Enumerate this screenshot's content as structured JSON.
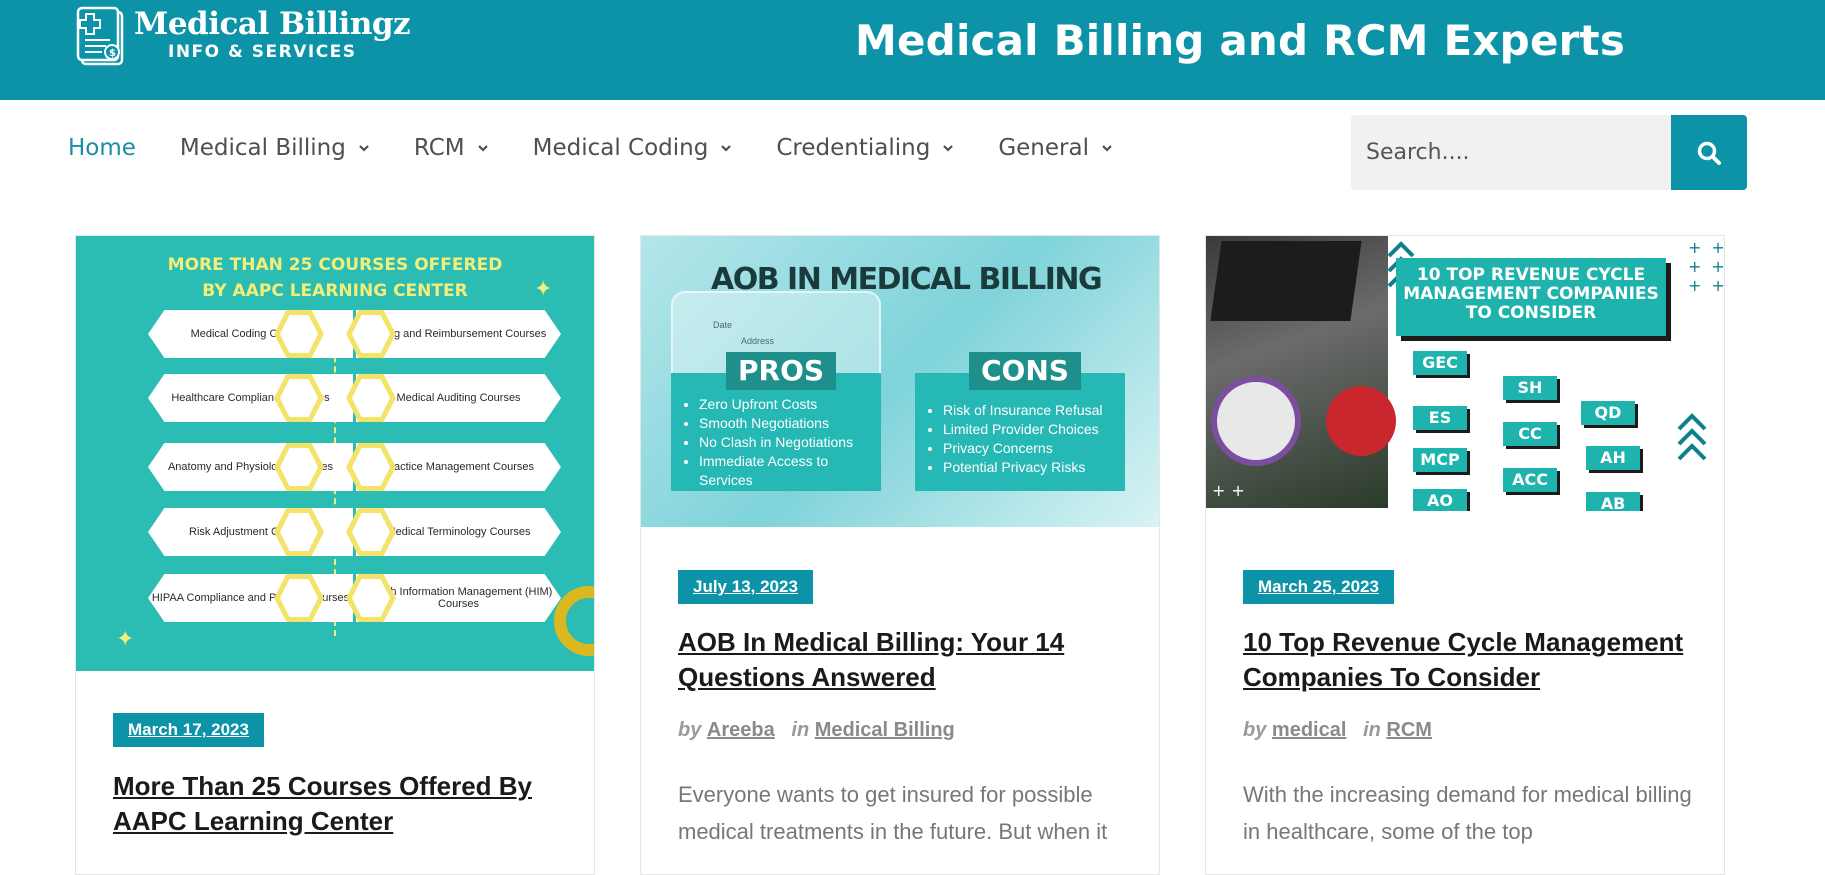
{
  "header": {
    "logo_name": "Medical Billingz",
    "logo_sub": "INFO & SERVICES",
    "tagline": "Medical Billing and RCM Experts"
  },
  "nav": {
    "items": [
      {
        "label": "Home",
        "active": true,
        "dropdown": false
      },
      {
        "label": "Medical Billing",
        "active": false,
        "dropdown": true
      },
      {
        "label": "RCM",
        "active": false,
        "dropdown": true
      },
      {
        "label": "Medical Coding",
        "active": false,
        "dropdown": true
      },
      {
        "label": "Credentialing",
        "active": false,
        "dropdown": true
      },
      {
        "label": "General",
        "active": false,
        "dropdown": true
      }
    ]
  },
  "search": {
    "placeholder": "Search....",
    "icon": "search-icon"
  },
  "colors": {
    "brand": "#0c93a8",
    "text": "#1a1a1a",
    "muted": "#777777",
    "nav_text": "#4f4f4f"
  },
  "cards": [
    {
      "date": "March 17, 2023",
      "title": "More Than 25 Courses Offered By AAPC Learning Center",
      "image": {
        "title_line1": "MORE THAN 25 COURSES OFFERED",
        "title_line2": "BY AAPC LEARNING CENTER",
        "left": [
          "Medical Coding Courses",
          "Healthcare Compliance Courses",
          "Anatomy and Physiology Courses",
          "Risk Adjustment Courses",
          "HIPAA Compliance and Privacy Courses"
        ],
        "right": [
          "Billing and Reimbursement Courses",
          "Medical Auditing Courses",
          "Practice Management Courses",
          "Medical Terminology Courses",
          "Health Information Management (HIM) Courses"
        ]
      }
    },
    {
      "date": "July 13, 2023",
      "title": "AOB In Medical Billing: Your 14 Questions Answered",
      "by_label": "by",
      "author": "Areeba",
      "in_label": "in",
      "category": "Medical Billing",
      "excerpt": "Everyone wants to get insured for possible medical treatments in the future. But when it",
      "image": {
        "title": "AOB IN MEDICAL BILLING",
        "pros_label": "PROS",
        "cons_label": "CONS",
        "pros": [
          "Zero Upfront Costs",
          "Smooth Negotiations",
          "No Clash in Negotiations",
          "Immediate Access to Services"
        ],
        "cons": [
          "Risk of Insurance Refusal",
          "Limited Provider Choices",
          "Privacy Concerns",
          "Potential Privacy Risks"
        ],
        "form_date": "Date",
        "form_address": "Address"
      }
    },
    {
      "date": "March 25, 2023",
      "title": "10 Top Revenue Cycle Management Companies To Consider",
      "by_label": "by",
      "author": "medical",
      "in_label": "in",
      "category": "RCM",
      "excerpt": "With the increasing demand for medical billing in healthcare, some of the top",
      "image": {
        "banner": "10 TOP REVENUE CYCLE MANAGEMENT COMPANIES TO CONSIDER",
        "tags": [
          "GEC",
          "ES",
          "MCP",
          "AO",
          "SH",
          "CC",
          "ACC",
          "QD",
          "AH",
          "AB"
        ]
      }
    }
  ]
}
